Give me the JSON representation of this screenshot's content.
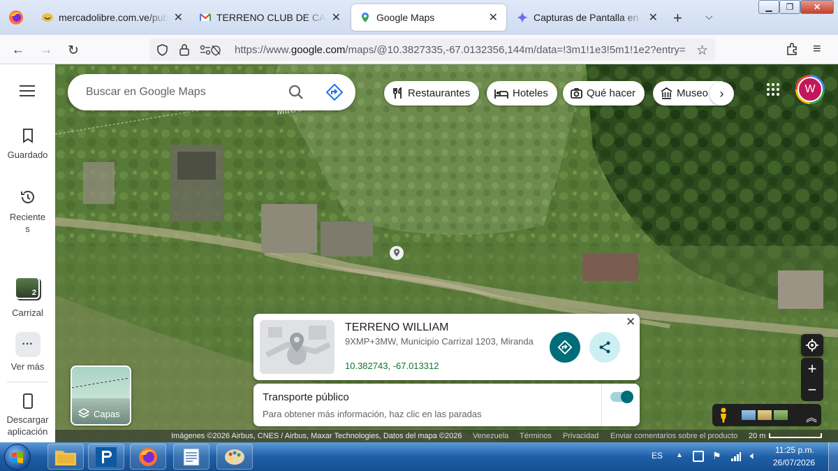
{
  "tabs": [
    {
      "label": "mercadolibre.com.ve/public",
      "icon": "smile-favicon-icon",
      "active": false
    },
    {
      "label": "TERRENO CLUB DE CAMPO",
      "icon": "gmail-icon",
      "active": false
    },
    {
      "label": "Google Maps",
      "icon": "maps-pin-icon",
      "active": true
    },
    {
      "label": "Capturas de Pantalla en Wir",
      "icon": "gemini-star-icon",
      "active": false
    }
  ],
  "url": {
    "prefix": "https://www.",
    "host": "google.com",
    "rest": "/maps/@10.3827335,-67.0132356,144m/data=!3m1!1e3!5m1!1e2?entry="
  },
  "rail": {
    "saved": "Guardado",
    "recent_line1": "Reciente",
    "recent_line2": "s",
    "recent_place": "Carrizal",
    "recent_place_badge": "2",
    "more": "Ver más",
    "download_line1": "Descargar",
    "download_line2": "aplicación"
  },
  "search": {
    "placeholder": "Buscar en Google Maps"
  },
  "chips": [
    "Restaurantes",
    "Hoteles",
    "Qué hacer",
    "Museo"
  ],
  "account": {
    "initial": "W",
    "color": "#c2185b"
  },
  "map_label": "MIRANDA",
  "place": {
    "title": "TERRENO WILLIAM",
    "address": "9XMP+3MW, Municipio Carrizal 1203, Miranda",
    "coords": "10.382743, -67.013312"
  },
  "transit": {
    "title": "Transporte público",
    "subtitle": "Para obtener más información, haz clic en las paradas",
    "toggle_on": true
  },
  "layers": {
    "label": "Capas"
  },
  "attribution": {
    "imagery": "Imágenes ©2026 Airbus, CNES / Airbus, Maxar Technologies, Datos del mapa ©2026",
    "country": "Venezuela",
    "terms": "Términos",
    "privacy": "Privacidad",
    "feedback": "Enviar comentarios sobre el producto",
    "scale": "20 m"
  },
  "taskbar": {
    "lang": "ES",
    "time": "11:25 p.m.",
    "date": "26/07/2026"
  },
  "colors": {
    "accent": "#137333",
    "teal": "#006d7a",
    "brand_blue": "#1a73e8"
  }
}
